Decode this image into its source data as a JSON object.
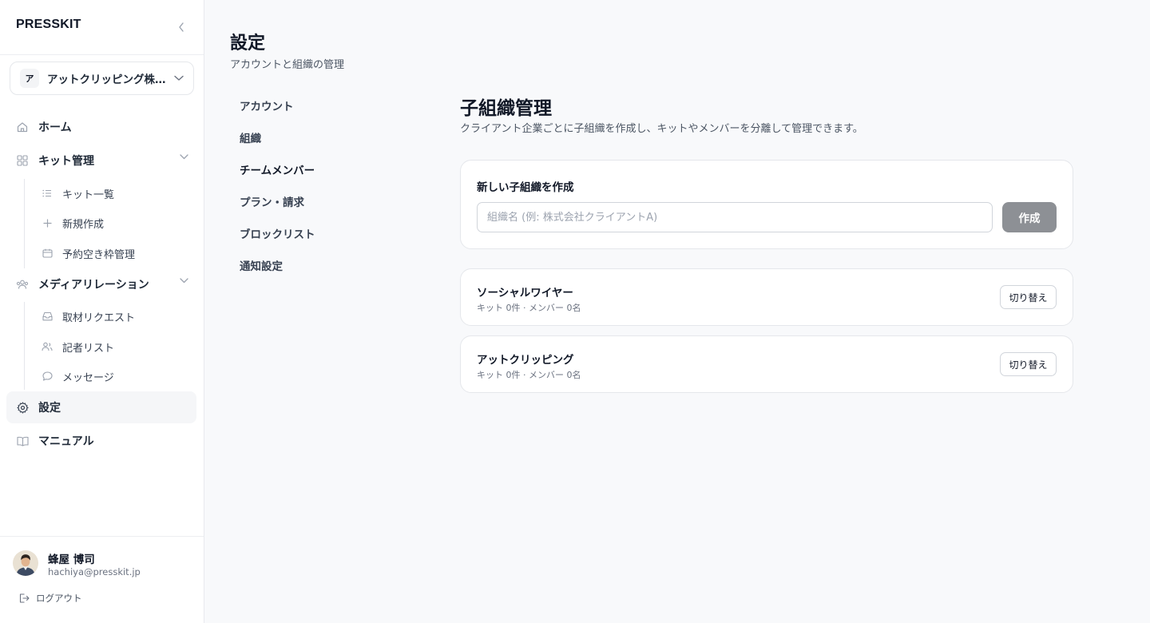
{
  "brand": "PRESSKIT",
  "org_switcher": {
    "avatar": "ア",
    "name": "アットクリッピング株式会社"
  },
  "nav": {
    "home": "ホーム",
    "kit": "キット管理",
    "kit_sub": [
      "キット一覧",
      "新規作成",
      "予約空き枠管理"
    ],
    "media": "メディアリレーション",
    "media_sub": [
      "取材リクエスト",
      "記者リスト",
      "メッセージ"
    ],
    "settings": "設定",
    "manual": "マニュアル"
  },
  "user": {
    "name": "蜂屋 博司",
    "email": "hachiya@presskit.jp",
    "logout": "ログアウト"
  },
  "page": {
    "title": "設定",
    "subtitle": "アカウントと組織の管理"
  },
  "settings_nav": [
    "アカウント",
    "組織",
    "チームメンバー",
    "プラン・請求",
    "ブロックリスト",
    "通知設定"
  ],
  "settings_nav_active": "チームメンバー",
  "section": {
    "title": "子組織管理",
    "description": "クライアント企業ごとに子組織を作成し、キットやメンバーを分離して管理できます。"
  },
  "create": {
    "title": "新しい子組織を作成",
    "placeholder": "組織名 (例: 株式会社クライアントA)",
    "value": "",
    "button": "作成"
  },
  "child_orgs": [
    {
      "name": "ソーシャルワイヤー",
      "meta": "キット 0件 · メンバー 0名",
      "button": "切り替え"
    },
    {
      "name": "アットクリッピング",
      "meta": "キット 0件 · メンバー 0名",
      "button": "切り替え"
    }
  ],
  "icons": {
    "collapse": "chevron-left-icon",
    "home": "home-icon",
    "kit": "grid-icon",
    "kit_list": "list-icon",
    "new": "plus-icon",
    "calendar": "calendar-icon",
    "media": "people-icon",
    "inbox": "inbox-icon",
    "users": "users-icon",
    "message": "chat-icon",
    "settings": "gear-icon",
    "manual": "book-icon",
    "logout": "logout-icon"
  },
  "colors": {
    "sidebar_bg": "#ffffff",
    "page_bg": "#f8f9fb",
    "active_nav_bg": "#f5f6f8",
    "primary_button_disabled": "#8d9095"
  }
}
